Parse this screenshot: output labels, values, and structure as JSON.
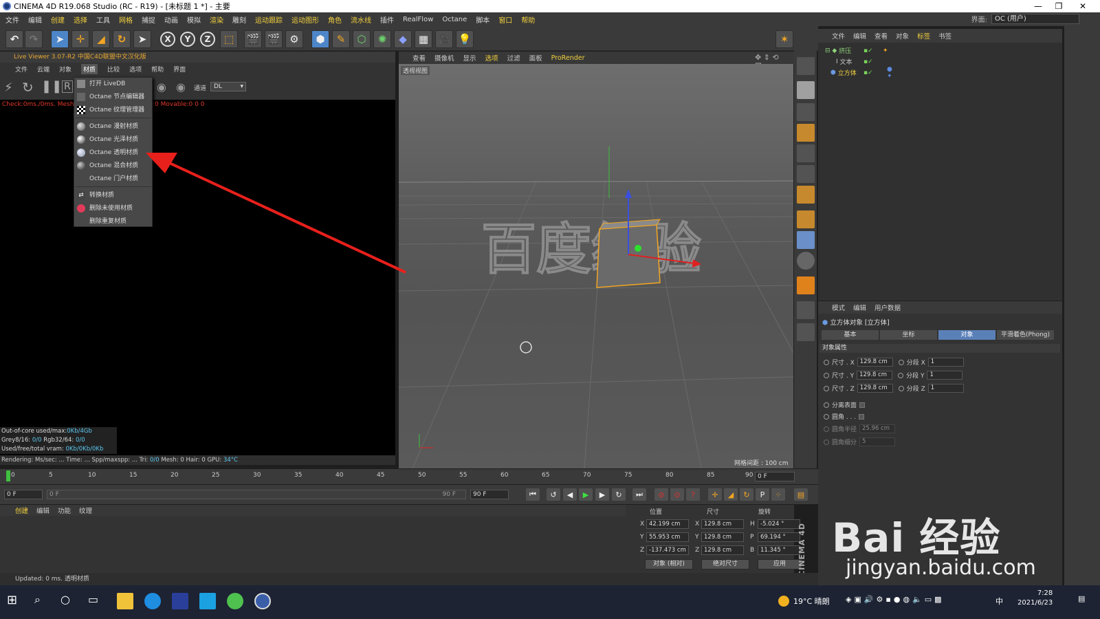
{
  "window": {
    "title": "CINEMA 4D R19.068 Studio (RC - R19) - [未标题 1 *] - 主要"
  },
  "menubar": {
    "items": [
      "文件",
      "编辑",
      "创建",
      "选择",
      "工具",
      "网格",
      "捕捉",
      "动画",
      "模拟",
      "渲染",
      "雕刻",
      "运动跟踪",
      "运动图形",
      "角色",
      "流水线",
      "插件",
      "RealFlow",
      "Octane",
      "脚本",
      "窗口",
      "帮助"
    ],
    "layout_label": "界面:",
    "layout_value": "OC (用户)"
  },
  "live_viewer": {
    "title": "Live Viewer 3.07-R2 中国C4D联盟中文汉化版",
    "menu": [
      "文件",
      "云端",
      "对象",
      "材质",
      "比较",
      "选项",
      "帮助",
      "界面"
    ],
    "channel_label": "通道",
    "channel_value": "DL",
    "check_text": "Check:0ms./0ms. MeshG",
    "check_text2": ":0 Movable:0  0 0",
    "stats": [
      {
        "label": "Out-of-core used/max:",
        "value": "0Kb/4Gb"
      },
      {
        "label": "Grey8/16: ",
        "value": "0/0",
        "label2": "        Rgb32/64: ",
        "value2": "0/0"
      },
      {
        "label": "Used/free/total vram: ",
        "value": "0Kb/0Kb/0Kb"
      }
    ],
    "render_line": {
      "a": "Rendering:      Ms/sec: ...  Time: ...      Spp/maxspp: ...  Tri: ",
      "tri": "0/0",
      "b": "  Mesh: 0     Hair: 0     GPU: ",
      "gpu": "34°C"
    }
  },
  "dropdown": {
    "items": [
      {
        "label": "打开 LiveDB",
        "icon": "grid-icon"
      },
      {
        "label": "Octane 节点编辑器",
        "icon": "node-icon"
      },
      {
        "label": "Octane 纹理管理器",
        "icon": "checker-icon"
      },
      {
        "label": "Octane 漫射材质",
        "icon": "sphere-icon"
      },
      {
        "label": "Octane 光泽材质",
        "icon": "sphere-icon"
      },
      {
        "label": "Octane 透明材质",
        "icon": "sphere-icon"
      },
      {
        "label": "Octane 混合材质",
        "icon": "sphere-icon"
      },
      {
        "label": "Octane 门户材质",
        "icon": "none"
      },
      {
        "label": "转换材质",
        "icon": "convert-icon"
      },
      {
        "label": "删除未使用材质",
        "icon": "delete-icon"
      },
      {
        "label": "删除重复材质",
        "icon": "none"
      }
    ]
  },
  "viewport": {
    "menu": [
      "查看",
      "摄像机",
      "显示",
      "选项",
      "过滤",
      "面板",
      "ProRender"
    ],
    "label": "透视视图",
    "grid_distance": "网格间距 : 100 cm",
    "scene_text": "百度经验"
  },
  "object_manager": {
    "menu": [
      "文件",
      "编辑",
      "查看",
      "对象",
      "标签",
      "书签"
    ],
    "objects": [
      {
        "name": "挤压",
        "color": "#8fd47a"
      },
      {
        "name": "文本",
        "color": "#cccccc"
      },
      {
        "name": "立方体",
        "color": "#f3d13d"
      }
    ]
  },
  "attribute_manager": {
    "menu": [
      "模式",
      "编辑",
      "用户数据"
    ],
    "object_title": "立方体对象 [立方体]",
    "tabs": [
      "基本",
      "坐标",
      "对象",
      "平滑着色(Phong)"
    ],
    "active_tab": "对象",
    "section": "对象属性",
    "size": [
      {
        "label": "尺寸 . X",
        "value": "129.8 cm",
        "seg_label": "分段 X",
        "seg": "1"
      },
      {
        "label": "尺寸 . Y",
        "value": "129.8 cm",
        "seg_label": "分段 Y",
        "seg": "1"
      },
      {
        "label": "尺寸 . Z",
        "value": "129.8 cm",
        "seg_label": "分段 Z",
        "seg": "1"
      }
    ],
    "separate_faces": "分离表面",
    "fillet": "圆角 . . .",
    "fillet_radius_label": "圆角半径",
    "fillet_radius": "25.96 cm",
    "fillet_sub_label": "圆角细分",
    "fillet_sub": "5"
  },
  "timeline": {
    "ticks": [
      "0",
      "5",
      "10",
      "15",
      "20",
      "25",
      "30",
      "35",
      "40",
      "45",
      "50",
      "55",
      "60",
      "65",
      "70",
      "75",
      "80",
      "85",
      "90"
    ],
    "current_frame": "0 F",
    "start": "0 F",
    "range_start": "0 F",
    "range_end": "90 F",
    "end": "90 F"
  },
  "materials": {
    "menu": [
      "创建",
      "编辑",
      "功能",
      "纹理"
    ]
  },
  "coords": {
    "headers": [
      "位置",
      "尺寸",
      "旋转"
    ],
    "rows": [
      {
        "axis": "X",
        "pos": "42.199 cm",
        "size": "129.8 cm",
        "rlabel": "H",
        "rot": "-5.024 °"
      },
      {
        "axis": "Y",
        "pos": "55.953 cm",
        "size": "129.8 cm",
        "rlabel": "P",
        "rot": "69.194 °"
      },
      {
        "axis": "Z",
        "pos": "-137.473 cm",
        "size": "129.8 cm",
        "rlabel": "B",
        "rot": "11.345 °"
      }
    ],
    "mode1": "对象 (相对)",
    "mode2": "绝对尺寸",
    "apply": "应用"
  },
  "status": {
    "text": "Updated: 0 ms.    透明材质"
  },
  "brand": {
    "maxon": "MAXON CINEMA 4D"
  },
  "watermark": {
    "line1": "Bai  经验",
    "line2": "jingyan.baidu.com"
  },
  "taskbar": {
    "weather": "19°C  晴朗",
    "time": "7:28",
    "date": "2021/6/23",
    "ime": "中"
  },
  "colors": {
    "accent": "#f3d13d",
    "active_tab": "#5a80b8",
    "arrow": "#e8201c"
  }
}
